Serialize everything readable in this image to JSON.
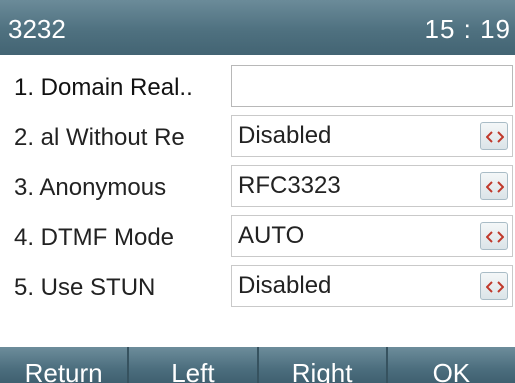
{
  "status": {
    "account": "3232",
    "time": "15 : 19"
  },
  "menu": {
    "items": [
      {
        "label": "1.  Domain Real..",
        "value": "",
        "has_switch": false
      },
      {
        "label": "2.  al Without Re",
        "value": "Disabled",
        "has_switch": true
      },
      {
        "label": "3.  Anonymous",
        "value": "RFC3323",
        "has_switch": true
      },
      {
        "label": "4.  DTMF Mode",
        "value": "AUTO",
        "has_switch": true
      },
      {
        "label": "5.  Use STUN",
        "value": "Disabled",
        "has_switch": true
      }
    ]
  },
  "softkeys": {
    "return_label": "Return",
    "left_label": "Left",
    "right_label": "Right",
    "ok_label": "OK"
  },
  "colors": {
    "bar_accent": "#4f7180",
    "switch_arrow": "#c0392b"
  },
  "icons": {
    "switch": "left-right-arrows-icon"
  }
}
